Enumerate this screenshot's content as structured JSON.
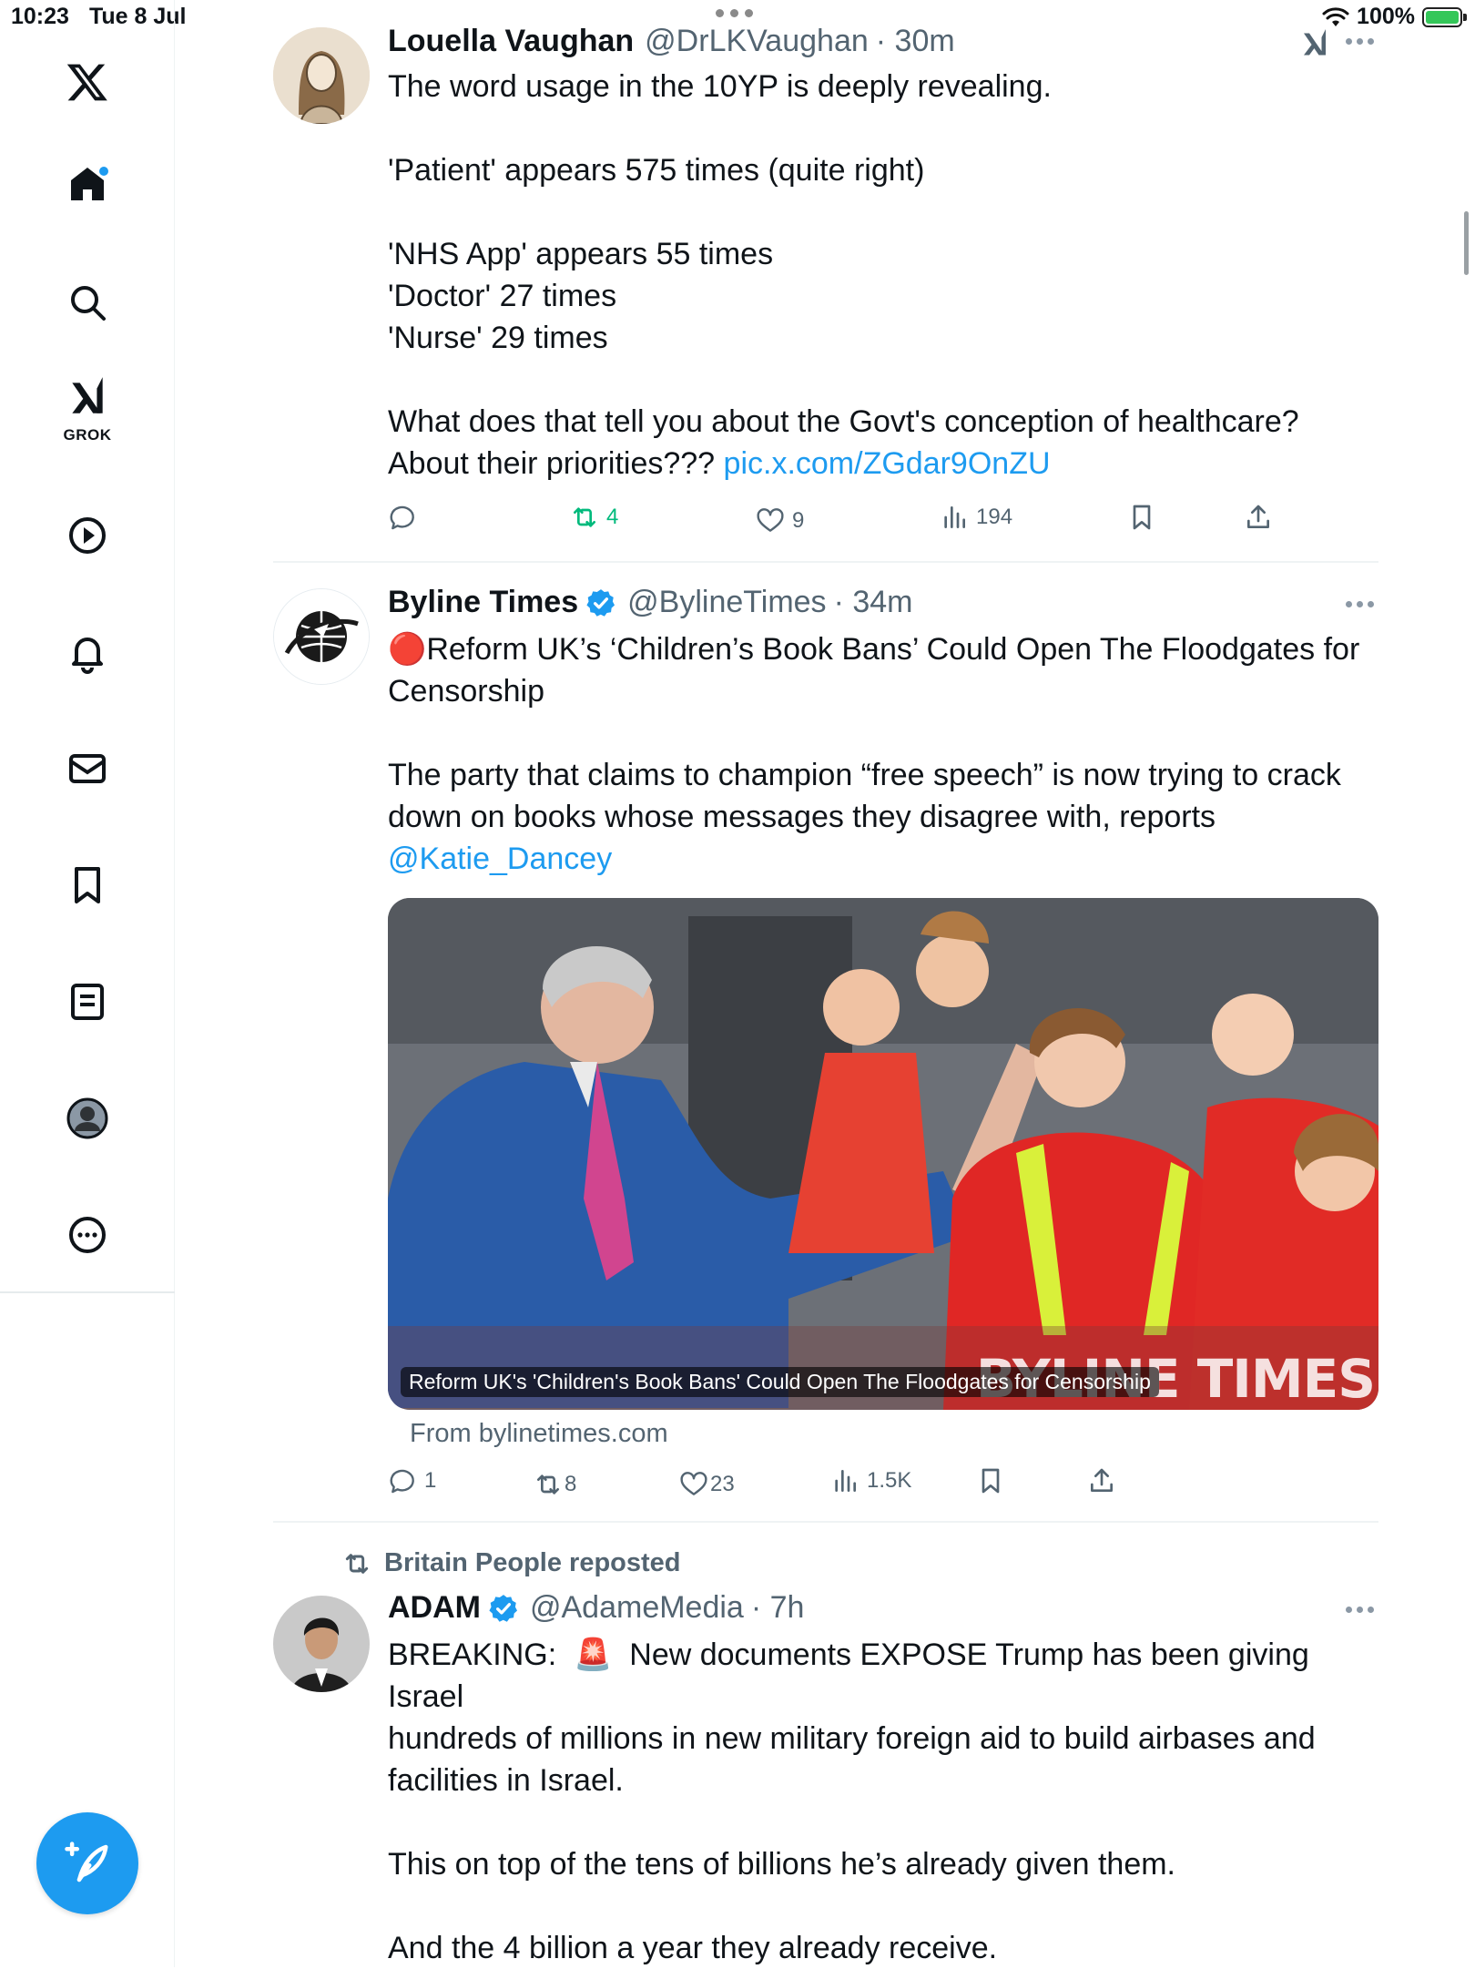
{
  "status_bar": {
    "time": "10:23",
    "date": "Tue 8 Jul",
    "battery": "100%"
  },
  "sidebar": {
    "items": [
      {
        "icon": "x-logo-icon"
      },
      {
        "icon": "home-icon"
      },
      {
        "icon": "search-icon"
      },
      {
        "icon": "grok-icon",
        "label": "GROK"
      },
      {
        "icon": "video-play-icon"
      },
      {
        "icon": "bell-icon"
      },
      {
        "icon": "mail-icon"
      },
      {
        "icon": "bookmark-icon"
      },
      {
        "icon": "list-icon"
      },
      {
        "icon": "profile-icon"
      },
      {
        "icon": "more-circle-icon"
      }
    ],
    "compose_icon": "compose-icon"
  },
  "tweets": [
    {
      "name": "Louella Vaughan",
      "handle": "@DrLKVaughan",
      "time": "· 30m",
      "text_lines": [
        "The word usage in the 10YP is deeply revealing.",
        "",
        "'Patient' appears 575 times (quite right)",
        "",
        "'NHS App' appears 55 times",
        "'Doctor' 27 times",
        "'Nurse' 29 times",
        "",
        "What does that tell you about the Govt's conception of healthcare?"
      ],
      "last_line": "About their priorities??? ",
      "link": "pic.x.com/ZGdar9OnZU",
      "stats": {
        "replies": "",
        "reposts": "4",
        "likes": "9",
        "views": "194"
      }
    },
    {
      "name": "Byline Times",
      "handle": "@BylineTimes",
      "time": "· 34m",
      "headline": "🔴Reform UK’s ‘Children’s Book Bans’ Could Open The Floodgates for\nCensorship",
      "text": "The party that claims to champion “free speech” is now trying to crack\ndown on books whose messages they disagree with, reports",
      "mention": "@Katie_Dancey",
      "card": {
        "caption": "Reform UK's 'Children's Book Bans' Could Open The Floodgates for Censorship",
        "watermark": "BYLINE TIMES",
        "from": "From bylinetimes.com"
      },
      "stats": {
        "replies": "1",
        "reposts": "8",
        "likes": "23",
        "views": "1.5K"
      }
    },
    {
      "repost_by": "Britain People reposted",
      "name": "ADAM",
      "handle": "@AdameMedia",
      "time": "· 7h",
      "text": "BREAKING:  🚨  New documents EXPOSE Trump has been giving Israel\nhundreds of millions in new military foreign aid to build airbases and\nfacilities in Israel.\n\nThis on top of the tens of billions he’s already given them.\n\nAnd the 4 billion a year they already receive."
    }
  ],
  "colors": {
    "accent": "#1d9bf0",
    "repost_green": "#00ba7c",
    "muted": "#536471"
  }
}
